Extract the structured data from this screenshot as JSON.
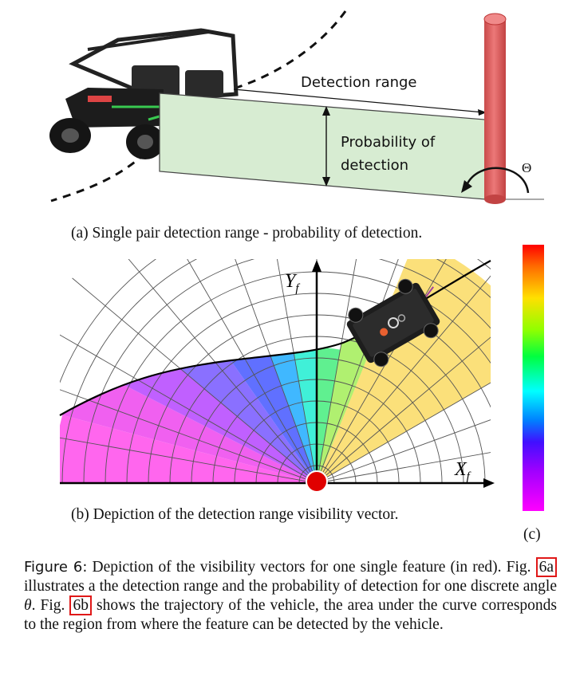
{
  "subfig_a": {
    "detection_range_label": "Detection range",
    "probability_label_line1": "Probability of",
    "probability_label_line2": "detection",
    "theta_label": "Θ",
    "caption": "(a) Single pair detection range - probability of detection.",
    "colors": {
      "panel_fill": "#d7ecd2",
      "feature_pillar": "#e06666",
      "vehicle": "#1f1f1f"
    }
  },
  "subfig_b": {
    "y_axis_label": "Y",
    "y_axis_subscript": "f",
    "x_axis_label": "X",
    "x_axis_subscript": "f",
    "caption": "(b) Depiction of the detection range visibility vector.",
    "colors": {
      "feature_marker": "#e00000",
      "grid": "#555555",
      "curve": "#000000"
    }
  },
  "subfig_c": {
    "label": "(c)",
    "colorbar_stops": [
      "#ff0000",
      "#ff8000",
      "#ffff00",
      "#80ff00",
      "#00ff40",
      "#00ffff",
      "#0080ff",
      "#4000ff",
      "#a000ff",
      "#ff00ff"
    ]
  },
  "figure_caption": {
    "prefix": "Figure 6:",
    "part1": " Depiction of the visibility vectors for one single feature (in red). Fig. ",
    "ref_a": "6a",
    "part2": " illustrates a the detection range and the probability of detection for one discrete angle ",
    "theta": "θ",
    "part3": ". Fig. ",
    "ref_b": "6b",
    "part4": " shows the trajectory of the vehicle, the area under the curve corresponds to the region from where the feature can be detected by the vehicle."
  }
}
